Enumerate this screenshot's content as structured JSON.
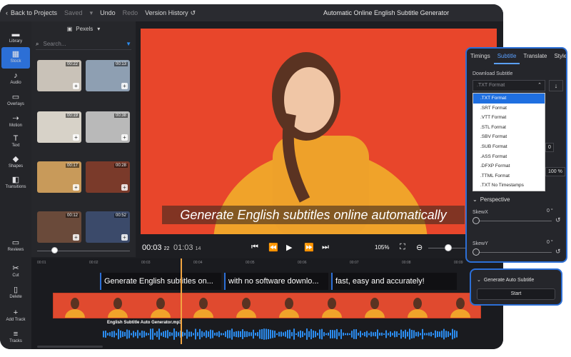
{
  "topbar": {
    "back": "Back to Projects",
    "saved": "Saved",
    "undo": "Undo",
    "redo": "Redo",
    "version_history": "Version History",
    "title": "Automatic Online English Subtitle Generator"
  },
  "leftbar": {
    "items": [
      {
        "label": "Library",
        "icon": "folder-icon"
      },
      {
        "label": "Stock",
        "icon": "stock-icon"
      },
      {
        "label": "Audio",
        "icon": "music-note-icon"
      },
      {
        "label": "Overlays",
        "icon": "overlays-icon"
      },
      {
        "label": "Motion",
        "icon": "motion-icon"
      },
      {
        "label": "Text",
        "icon": "text-icon"
      },
      {
        "label": "Shapes",
        "icon": "shapes-icon"
      },
      {
        "label": "Transitions",
        "icon": "transitions-icon"
      },
      {
        "label": "Reviews",
        "icon": "chat-icon"
      },
      {
        "label": "Cut",
        "icon": "scissors-icon"
      },
      {
        "label": "Delete",
        "icon": "trash-icon"
      },
      {
        "label": "Add Track",
        "icon": "add-track-icon"
      },
      {
        "label": "Tracks",
        "icon": "layers-icon"
      }
    ]
  },
  "media": {
    "source": "Pexels",
    "search_placeholder": "Search...",
    "thumbs": [
      {
        "duration": "00:22",
        "color": "#c9c2b8"
      },
      {
        "duration": "00:13",
        "color": "#8e9fb2"
      },
      {
        "duration": "00:19",
        "color": "#d7d2c8"
      },
      {
        "duration": "00:38",
        "color": "#b9b9b9"
      },
      {
        "duration": "00:17",
        "color": "#c89a5a"
      },
      {
        "duration": "00:28",
        "color": "#7a3a2a"
      },
      {
        "duration": "00:12",
        "color": "#6a4a3a"
      },
      {
        "duration": "00:52",
        "color": "#3b4a6a"
      }
    ]
  },
  "preview": {
    "subtitle": "Generate English subtitles online automatically",
    "bg_color": "#e8462b"
  },
  "transport": {
    "current_time": "00:03",
    "current_frames": "22",
    "total_time": "01:03",
    "total_frames": "14",
    "zoom": "105%"
  },
  "timeline": {
    "ruler": [
      "00:01",
      "00:02",
      "00:03",
      "00:04",
      "00:05",
      "00:06",
      "00:07",
      "00:08",
      "00:09"
    ],
    "captions": [
      "Generate English subtitles on...",
      "with no software downlo...",
      "fast, easy and accurately!"
    ],
    "audio_label": "English Subtitle Auto Generator.mp3"
  },
  "panel": {
    "tabs": [
      "Timings",
      "Subtitle",
      "Translate",
      "Style"
    ],
    "active_tab": "Subtitle",
    "download_heading": "Download Subtitle",
    "selected_format": ".TXT Format",
    "formats": [
      ".TXT Format",
      ".SRT Format",
      ".VTT Format",
      ".STL Format",
      ".SBV Format",
      ".SUB Format",
      ".ASS Format",
      ".DFXP Format",
      ".TTML Format",
      ".TXT No Timestamps"
    ],
    "side_value_1": "0",
    "side_value_2": "100 %",
    "perspective_heading": "Perspective",
    "skewx_label": "SkewX",
    "skewx_value": "0 °",
    "skewy_label": "SkewY",
    "skewy_value": "0 °"
  },
  "auto_panel": {
    "heading": "Generate Auto Subtitle",
    "start": "Start"
  }
}
